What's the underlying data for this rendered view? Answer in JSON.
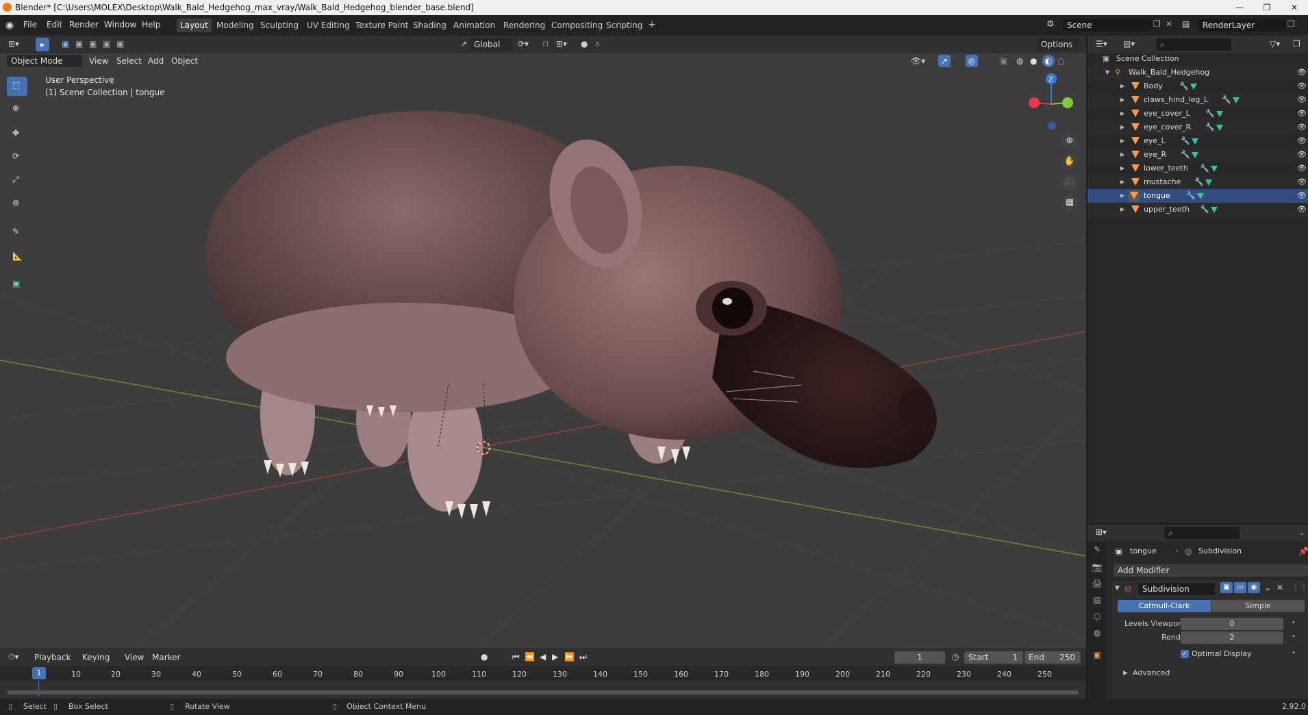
{
  "window": {
    "title": "Blender* [C:\\Users\\MOLEX\\Desktop\\Walk_Bald_Hedgehog_max_vray/Walk_Bald_Hedgehog_blender_base.blend]",
    "minimize": "—",
    "maximize": "❐",
    "close": "✕"
  },
  "menu": [
    "File",
    "Edit",
    "Render",
    "Window",
    "Help"
  ],
  "workspaces": [
    {
      "label": "Layout",
      "active": true
    },
    {
      "label": "Modeling"
    },
    {
      "label": "Sculpting"
    },
    {
      "label": "UV Editing"
    },
    {
      "label": "Texture Paint"
    },
    {
      "label": "Shading"
    },
    {
      "label": "Animation"
    },
    {
      "label": "Rendering"
    },
    {
      "label": "Compositing"
    },
    {
      "label": "Scripting"
    }
  ],
  "scene": {
    "name": "Scene",
    "view_layer": "RenderLayer"
  },
  "viewport_header": {
    "transform_orientation": "Global",
    "options": "Options",
    "mode": "Object Mode",
    "menus": [
      "View",
      "Select",
      "Add",
      "Object"
    ]
  },
  "viewport": {
    "perspective": "User Perspective",
    "collection_info": "(1) Scene Collection | tongue",
    "gizmo_axes": {
      "z": "Z",
      "z_color": "#2f7de1",
      "x_color": "#e8394a",
      "y_color": "#83c83a"
    }
  },
  "outliner": {
    "root": "Scene Collection",
    "armature": "Walk_Bald_Hedgehog",
    "objects": [
      "Body",
      "claws_hind_leg_L",
      "eye_cover_L",
      "eye_cover_R",
      "eye_L",
      "eye_R",
      "lower_teeth",
      "mustache",
      "tongue",
      "upper_teeth"
    ],
    "active_object": "tongue"
  },
  "properties": {
    "object": "tongue",
    "modifier_breadcrumb": "Subdivision",
    "add_modifier": "Add Modifier",
    "modifier_name": "Subdivision",
    "algorithm_options": [
      "Catmull-Clark",
      "Simple"
    ],
    "algorithm_selected": "Catmull-Clark",
    "levels_viewport_label": "Levels Viewport",
    "levels_viewport": "0",
    "render_label": "Render",
    "render": "2",
    "optimal_display_label": "Optimal Display",
    "optimal_display": true,
    "advanced": "Advanced"
  },
  "timeline": {
    "menus": [
      "Playback",
      "Keying",
      "View",
      "Marker"
    ],
    "current_frame": "1",
    "start_label": "Start",
    "start": "1",
    "end_label": "End",
    "end": "250",
    "ticks": [
      "1",
      "10",
      "20",
      "30",
      "40",
      "50",
      "60",
      "70",
      "80",
      "90",
      "100",
      "110",
      "120",
      "130",
      "140",
      "150",
      "160",
      "170",
      "180",
      "190",
      "200",
      "210",
      "220",
      "230",
      "240",
      "250"
    ]
  },
  "statusbar": {
    "select": "Select",
    "box_select": "Box Select",
    "rotate_view": "Rotate View",
    "context_menu": "Object Context Menu",
    "version": "2.92.0"
  }
}
